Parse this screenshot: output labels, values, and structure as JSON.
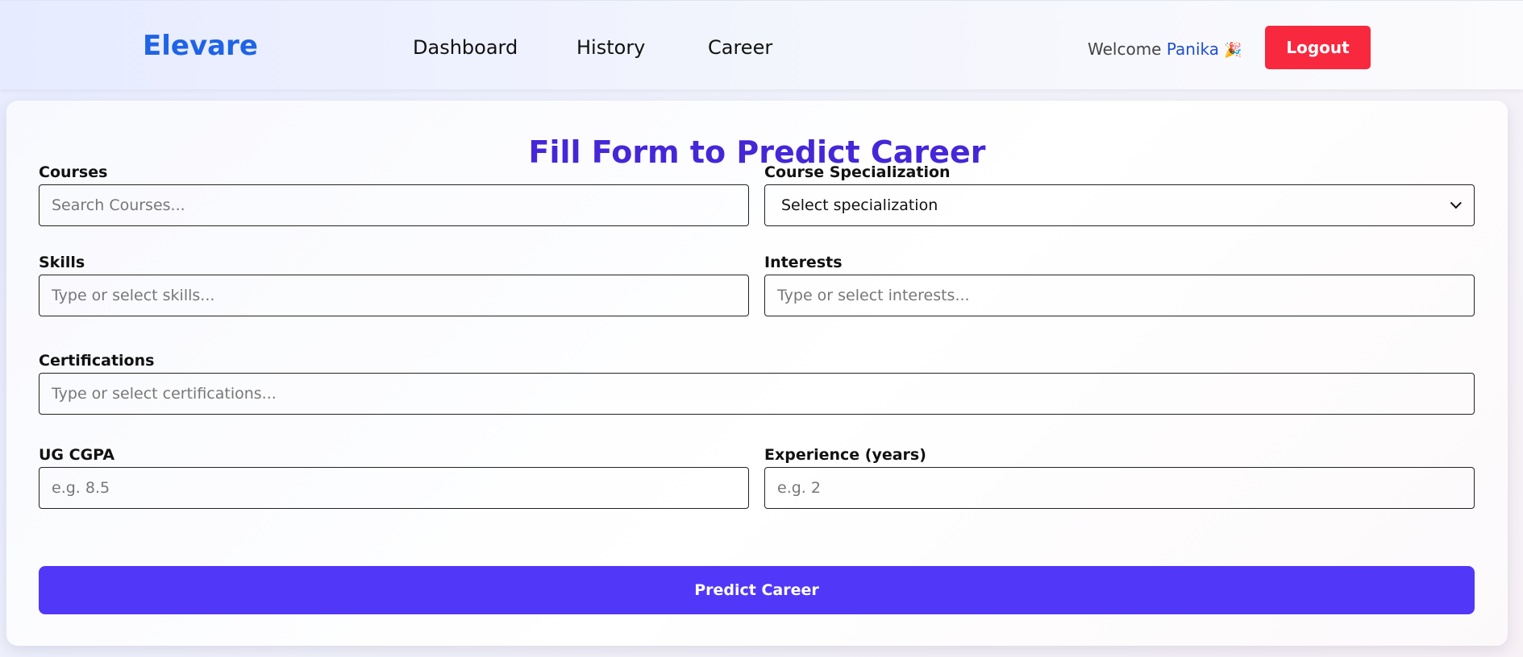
{
  "header": {
    "brand": "Elevare",
    "nav": [
      "Dashboard",
      "History",
      "Career"
    ],
    "welcome_prefix": "Welcome",
    "user_name": "Panika",
    "party_emoji": "🎉",
    "logout_label": "Logout"
  },
  "form": {
    "title": "Fill Form to Predict Career",
    "courses": {
      "label": "Courses",
      "placeholder": "Search Courses..."
    },
    "specialization": {
      "label": "Course Specialization",
      "selected": "Select specialization"
    },
    "skills": {
      "label": "Skills",
      "placeholder": "Type or select skills..."
    },
    "interests": {
      "label": "Interests",
      "placeholder": "Type or select interests..."
    },
    "certifications": {
      "label": "Certifications",
      "placeholder": "Type or select certifications..."
    },
    "cgpa": {
      "label": "UG CGPA",
      "placeholder": "e.g. 8.5"
    },
    "experience": {
      "label": "Experience (years)",
      "placeholder": "e.g. 2"
    },
    "submit_label": "Predict Career"
  },
  "colors": {
    "brand": "#1f63e6",
    "title": "#4527d8",
    "logout": "#f8283e",
    "primary_button": "#5138f8"
  },
  "icons": [
    "chevron-down-icon",
    "party-popper-icon"
  ]
}
